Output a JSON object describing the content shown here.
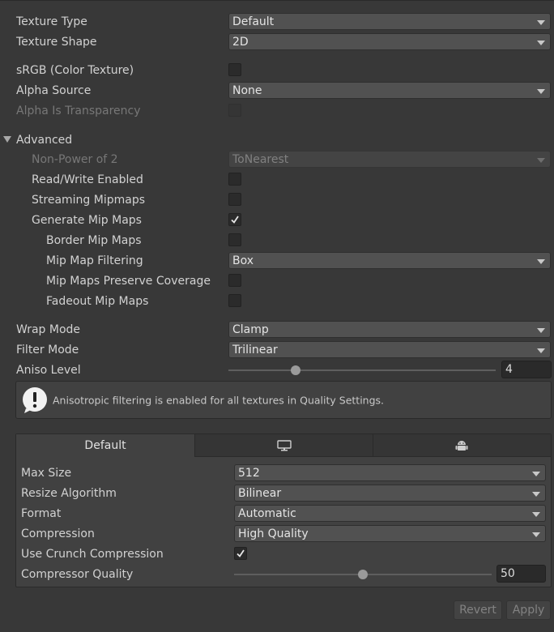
{
  "texture_type": {
    "label": "Texture Type",
    "value": "Default"
  },
  "texture_shape": {
    "label": "Texture Shape",
    "value": "2D"
  },
  "srgb": {
    "label": "sRGB (Color Texture)",
    "checked": false
  },
  "alpha_source": {
    "label": "Alpha Source",
    "value": "None"
  },
  "alpha_is_transparency": {
    "label": "Alpha Is Transparency",
    "checked": false
  },
  "advanced": {
    "label": "Advanced",
    "non_power_of_2": {
      "label": "Non-Power of 2",
      "value": "ToNearest"
    },
    "read_write": {
      "label": "Read/Write Enabled",
      "checked": false
    },
    "streaming_mipmaps": {
      "label": "Streaming Mipmaps",
      "checked": false
    },
    "generate_mip_maps": {
      "label": "Generate Mip Maps",
      "checked": true
    },
    "border_mip_maps": {
      "label": "Border Mip Maps",
      "checked": false
    },
    "mip_map_filtering": {
      "label": "Mip Map Filtering",
      "value": "Box"
    },
    "preserve_coverage": {
      "label": "Mip Maps Preserve Coverage",
      "checked": false
    },
    "fadeout_mip_maps": {
      "label": "Fadeout Mip Maps",
      "checked": false
    }
  },
  "wrap_mode": {
    "label": "Wrap Mode",
    "value": "Clamp"
  },
  "filter_mode": {
    "label": "Filter Mode",
    "value": "Trilinear"
  },
  "aniso_level": {
    "label": "Aniso Level",
    "value": "4",
    "fraction": 0.25
  },
  "help_box": {
    "text": "Anisotropic filtering is enabled for all textures in Quality Settings."
  },
  "platform_tabs": [
    {
      "label": "Default",
      "selected": true
    },
    {
      "icon": "monitor-icon",
      "selected": false
    },
    {
      "icon": "android-icon",
      "selected": false
    }
  ],
  "platform": {
    "max_size": {
      "label": "Max Size",
      "value": "512"
    },
    "resize_algorithm": {
      "label": "Resize Algorithm",
      "value": "Bilinear"
    },
    "format": {
      "label": "Format",
      "value": "Automatic"
    },
    "compression": {
      "label": "Compression",
      "value": "High Quality"
    },
    "use_crunch": {
      "label": "Use Crunch Compression",
      "checked": true
    },
    "compressor_quality": {
      "label": "Compressor Quality",
      "value": "50",
      "fraction": 0.5
    }
  },
  "buttons": {
    "revert": "Revert",
    "apply": "Apply"
  },
  "colors": {
    "background": "#383838",
    "field": "#515151",
    "checkbox": "#2b2b2b"
  }
}
